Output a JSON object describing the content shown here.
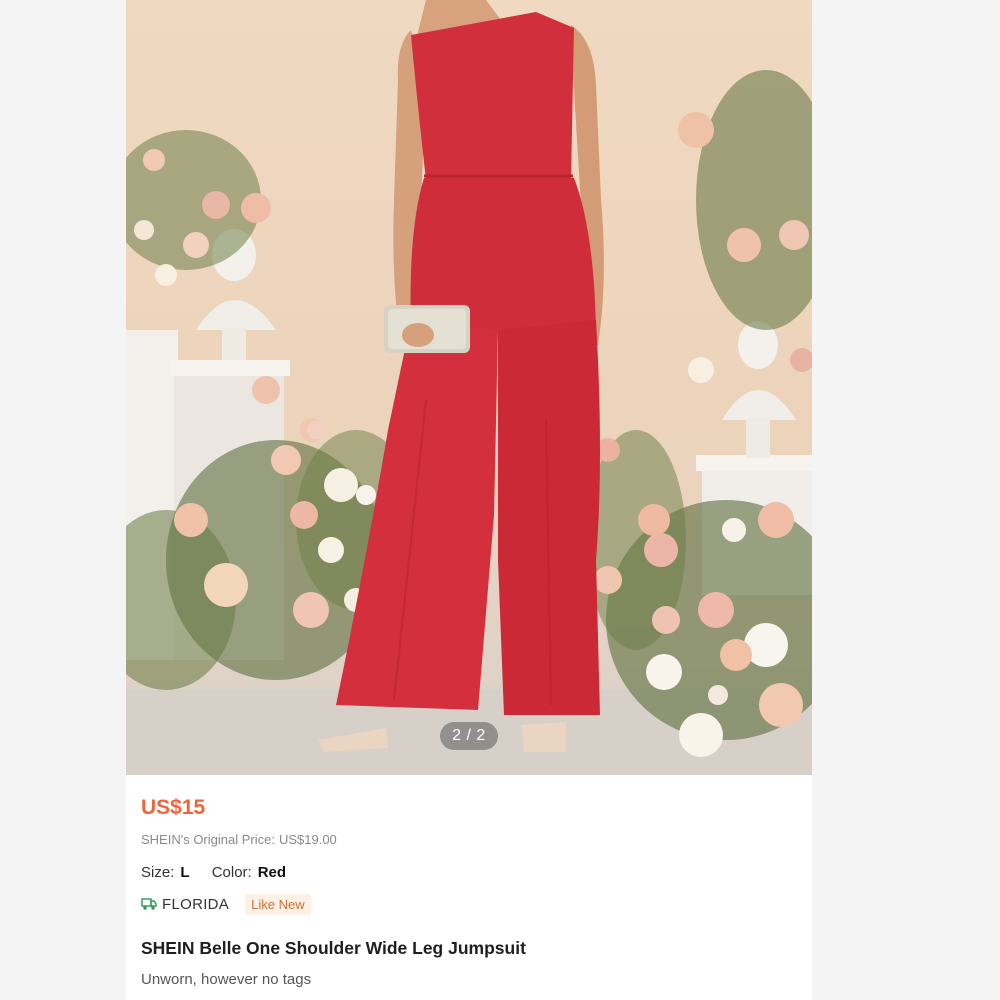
{
  "gallery": {
    "pager": "2 / 2",
    "image_subject": "red one shoulder wide leg jumpsuit"
  },
  "product": {
    "price": "US$15",
    "original_price_label": "SHEIN's Original Price:",
    "original_price_value": "US$19.00",
    "size_label": "Size:",
    "size_value": "L",
    "color_label": "Color:",
    "color_value": "Red",
    "location": "FLORIDA",
    "condition_badge": "Like New",
    "title": "SHEIN Belle One Shoulder Wide Leg Jumpsuit",
    "description": "Unworn, however no tags"
  },
  "colors": {
    "price": "#f0643c",
    "jumpsuit": "#d22f3c",
    "badge_bg": "#fdf1e6",
    "badge_text": "#c8733a",
    "shipping_icon": "#2e9a5a"
  },
  "icons": {
    "shipping": "truck-icon"
  }
}
